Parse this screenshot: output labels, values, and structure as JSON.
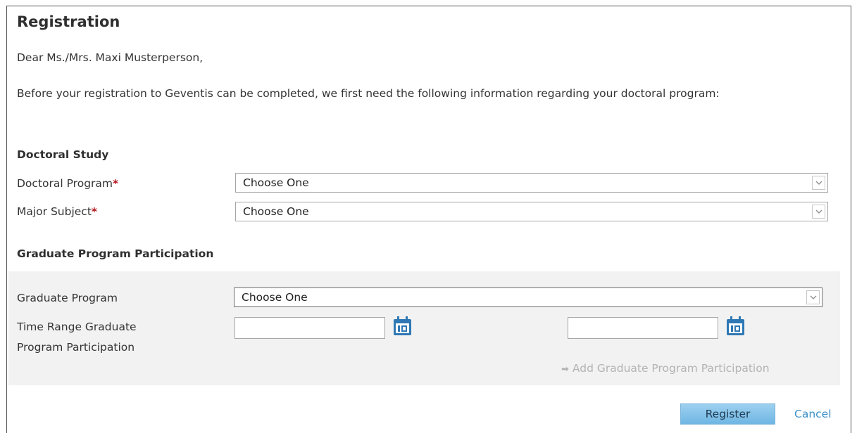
{
  "page": {
    "title": "Registration",
    "greeting": "Dear Ms./Mrs. Maxi Musterperson,",
    "intro": "Before your registration to Geventis can be completed, we first need the following information regarding your doctoral program:"
  },
  "doctoral_study": {
    "heading": "Doctoral Study",
    "required_marker": "*",
    "program": {
      "label": "Doctoral Program",
      "value": "Choose One"
    },
    "major": {
      "label": "Major Subject",
      "value": "Choose One"
    }
  },
  "graduate_program": {
    "heading": "Graduate Program Participation",
    "program": {
      "label": "Graduate Program",
      "value": "Choose One"
    },
    "time_range": {
      "label_line1": "Time Range Graduate",
      "label_line2": "Program Participation",
      "start_value": "",
      "end_value": ""
    },
    "add_link": "Add Graduate Program Participation",
    "add_link_icon": "arrow-right-icon"
  },
  "actions": {
    "register_label": "Register",
    "cancel_label": "Cancel"
  },
  "colors": {
    "accent": "#3a8fc9",
    "button": "#8cc8ec",
    "required": "#b5121b",
    "panel": "#f2f2f2"
  }
}
